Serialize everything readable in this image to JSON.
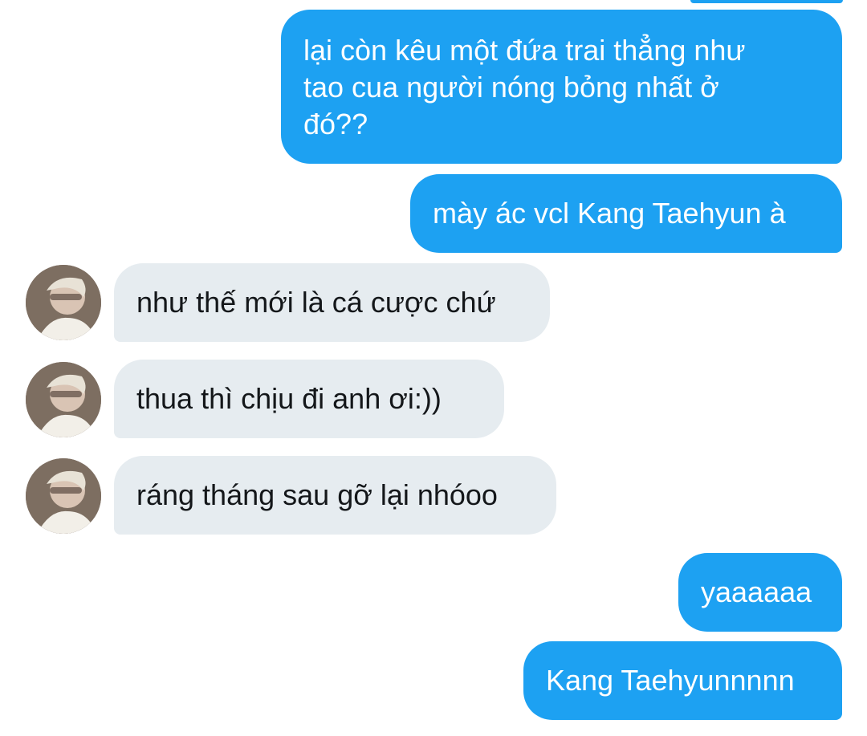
{
  "conversation": {
    "messages": [
      {
        "direction": "outgoing",
        "text": "lại còn kêu một đứa trai thẳng như\ntao cua người nóng bỏng nhất ở\nđó??"
      },
      {
        "direction": "outgoing",
        "text": "mày ác vcl Kang Taehyun à"
      },
      {
        "direction": "incoming",
        "text": "như thế mới là cá cược chứ"
      },
      {
        "direction": "incoming",
        "text": "thua thì chịu đi anh ơi:))"
      },
      {
        "direction": "incoming",
        "text": "ráng tháng sau gỡ lại nhóoo"
      },
      {
        "direction": "outgoing",
        "text": "yaaaaaa"
      },
      {
        "direction": "outgoing",
        "text": "Kang Taehyunnnnn"
      }
    ]
  },
  "colors": {
    "outgoing_bubble": "#1da1f2",
    "incoming_bubble": "#e6ecf0",
    "outgoing_text": "#ffffff",
    "incoming_text": "#14171a",
    "background": "#ffffff"
  },
  "icons": {
    "avatar": "contact-avatar-photo"
  }
}
